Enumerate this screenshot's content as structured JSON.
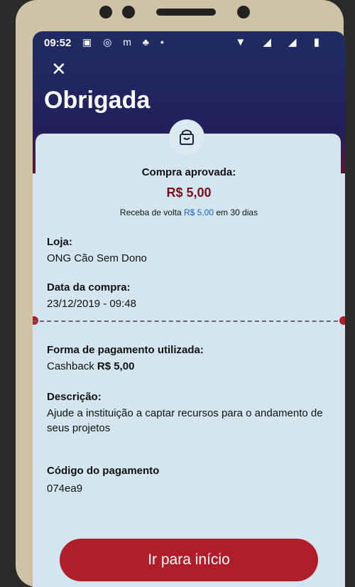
{
  "status_bar": {
    "time": "09:52",
    "left_icons": "▣ ◎ m ♣ •",
    "right_icons": "▼ ◢ ◢ ▮"
  },
  "header": {
    "close": "✕",
    "title": "Obrigada"
  },
  "summary": {
    "label": "Compra aprovada:",
    "amount": "R$ 5,00",
    "cashback_prefix": "Receba de volta",
    "cashback_amount": "R$ 5,00",
    "cashback_suffix": "em 30 dias"
  },
  "details": {
    "store_label": "Loja:",
    "store_value": "ONG Cão Sem Dono",
    "date_label": "Data da compra:",
    "date_value": "23/12/2019 - 09:48",
    "payment_label": "Forma de pagamento utilizada:",
    "payment_method": "Cashback",
    "payment_amount": "R$ 5,00",
    "description_label": "Descrição:",
    "description_value": "Ajude a instituição a captar recursos para o andamento de seus projetos",
    "code_label": "Código do pagamento",
    "code_value": "074ea9"
  },
  "cta": {
    "label": "Ir para início"
  },
  "colors": {
    "brand_red": "#b01e2a",
    "header_navy": "#1f2d63",
    "amount_red": "#7a0f1c",
    "link_blue": "#1a5fc9"
  }
}
